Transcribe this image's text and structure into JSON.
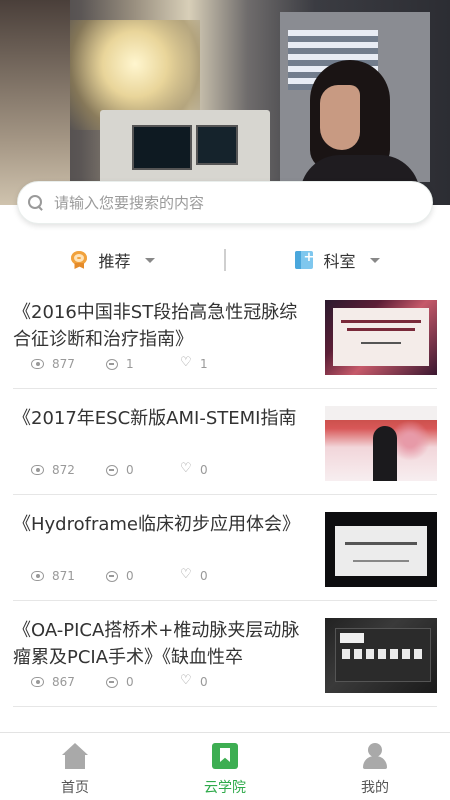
{
  "search": {
    "placeholder": "请输入您要搜索的内容"
  },
  "filters": [
    {
      "label": "推荐",
      "icon": "medal-icon"
    },
    {
      "label": "科室",
      "icon": "department-icon"
    }
  ],
  "articles": [
    {
      "title": "《2016中国非ST段抬高急性冠脉综合征诊断和治疗指南》",
      "views": "877",
      "comments": "1",
      "likes": "1"
    },
    {
      "title": "《2017年ESC新版AMI-STEMI指南",
      "views": "872",
      "comments": "0",
      "likes": "0"
    },
    {
      "title": "《Hydroframe临床初步应用体会》",
      "views": "871",
      "comments": "0",
      "likes": "0"
    },
    {
      "title": "《OA-PICA搭桥术+椎动脉夹层动脉瘤累及PCIA手术》《缺血性卒",
      "views": "867",
      "comments": "0",
      "likes": "0"
    }
  ],
  "bottom_nav": [
    {
      "label": "首页",
      "icon": "home-icon"
    },
    {
      "label": "云学院",
      "icon": "book-icon",
      "active": true
    },
    {
      "label": "我的",
      "icon": "user-icon"
    }
  ],
  "colors": {
    "accent": "#2faa4b",
    "text": "#333333",
    "muted": "#999999"
  }
}
